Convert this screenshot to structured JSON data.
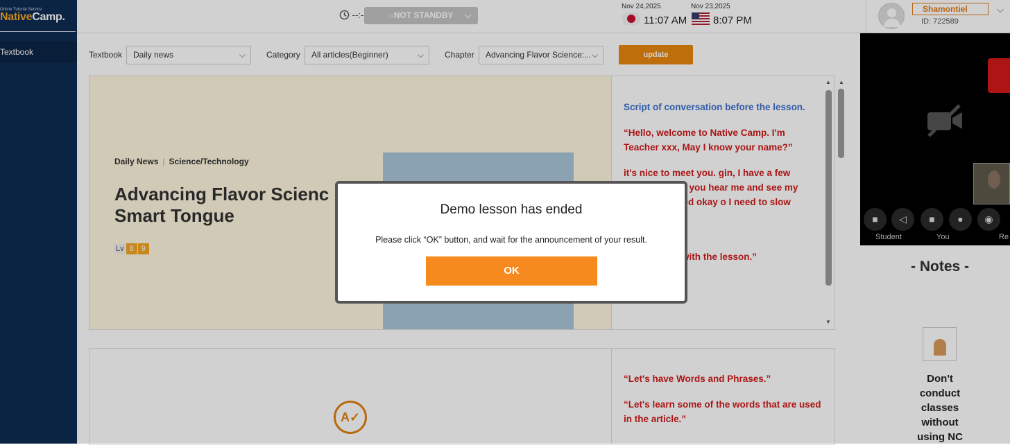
{
  "sidebar": {
    "logo_small": "Online Tutorial Service",
    "logo_prefix": "Native",
    "logo_suffix": "Camp.",
    "items": [
      {
        "label": "Textbook"
      }
    ]
  },
  "header": {
    "timer": "--:--",
    "status": "○NOT STANDBY",
    "tz1_date": "Nov 24,2025",
    "tz1_time": "11:07 AM",
    "tz2_date": "Nov 23,2025",
    "tz2_time": "8:07 PM",
    "user_name": "Shamontiel",
    "user_id": "ID: 722589"
  },
  "filters": {
    "textbook_label": "Textbook",
    "textbook_value": "Daily news",
    "category_label": "Category",
    "category_value": "All articles(Beginner)",
    "chapter_label": "Chapter",
    "chapter_value": "Advancing Flavor Science:...",
    "update_label": "update"
  },
  "article": {
    "category": "Daily News",
    "subcategory": "Science/Technology",
    "title": "Advancing Flavor Scienc Smart Tongue",
    "level_label": "Lv",
    "levels": [
      "8",
      "9"
    ]
  },
  "script": {
    "heading": "Script of conversation before the lesson.",
    "lines": [
      "“Hello, welcome to Native Camp. I'm Teacher xxx, May I know your name?”",
      "it's nice to meet you. gin, I have a few questions can you hear me and see my speaking speed okay o I need to slow down?”",
      "s get started with the lesson.”"
    ]
  },
  "script2": {
    "lines": [
      "“Let's have Words and Phrases.”",
      "“Let's learn some of the words that are used in the article.”"
    ]
  },
  "video": {
    "labels": [
      "Student",
      "You",
      "Re"
    ]
  },
  "notes": {
    "title": "- Notes -",
    "warning": "Don't conduct classes without using NC"
  },
  "modal": {
    "title": "Demo lesson has ended",
    "message": "Please click “OK” button, and wait for the announcement of your result.",
    "ok_label": "OK"
  }
}
